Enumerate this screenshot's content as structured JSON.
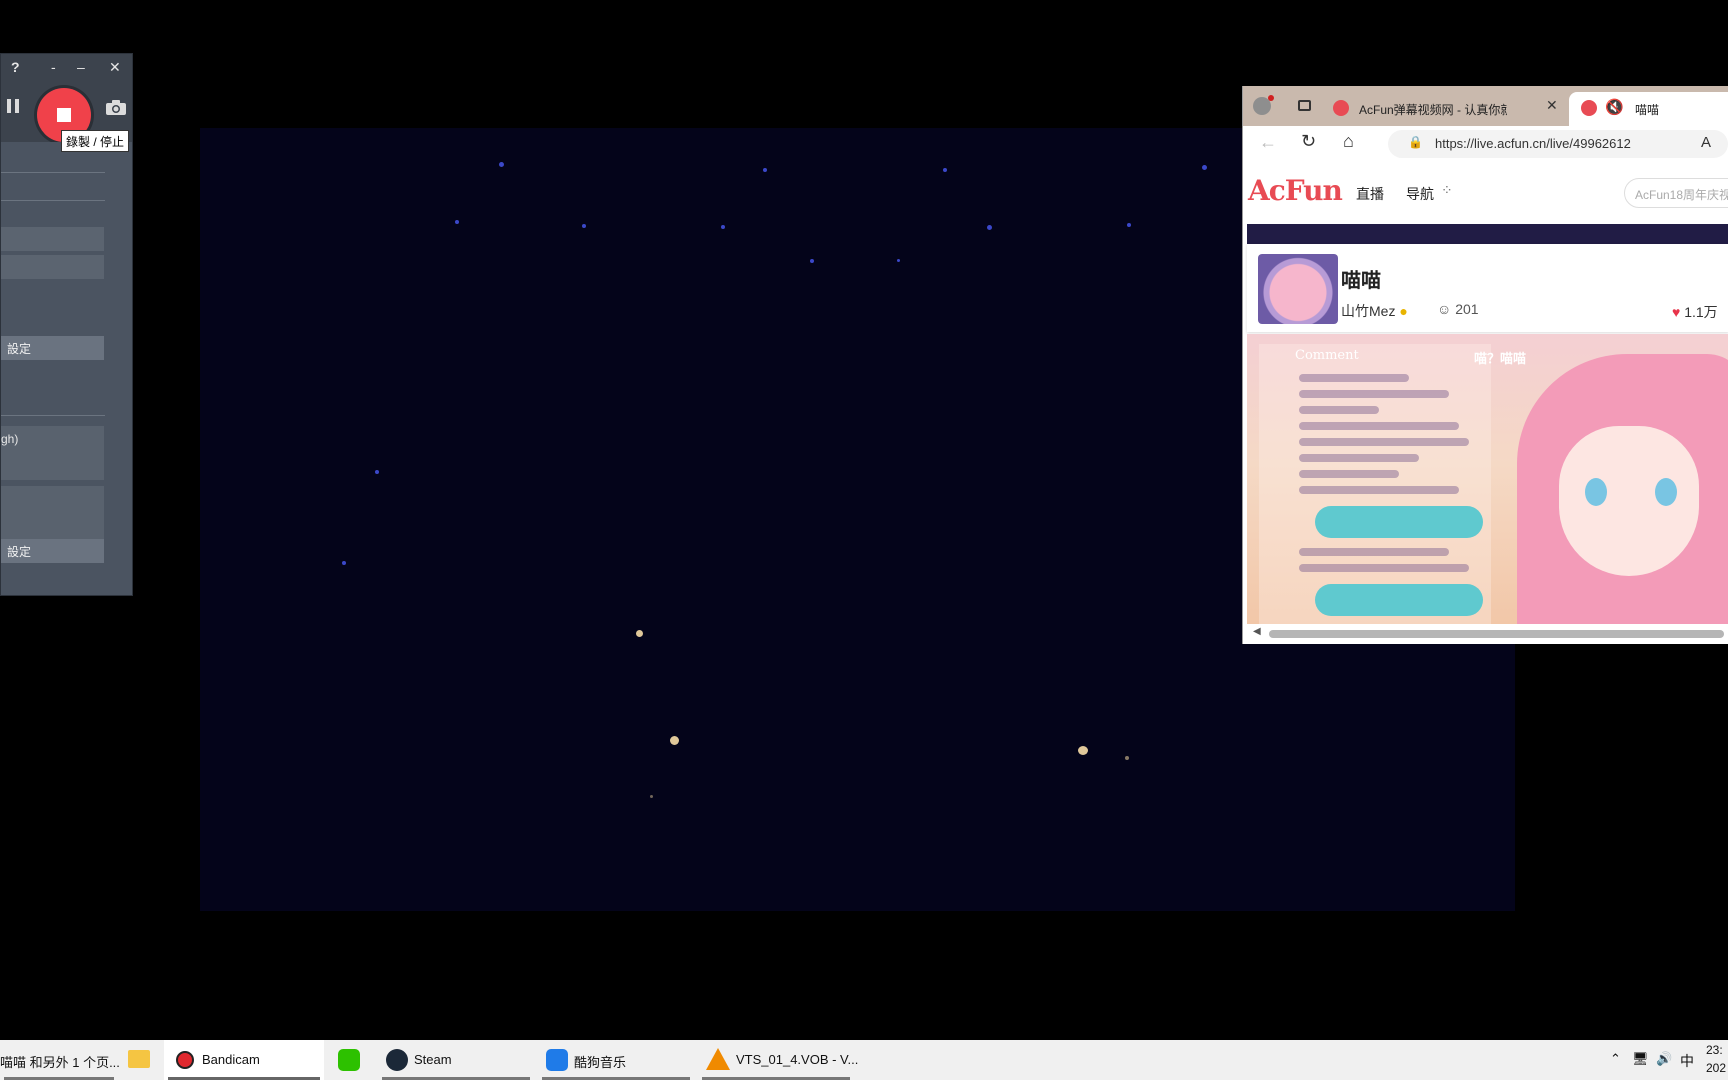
{
  "bandicam": {
    "help": "?",
    "minimize": "-",
    "restore": "–",
    "close": "✕",
    "tooltip": "錄製 / 停止",
    "settings_label_1": "設定",
    "settings_label_2": "設定",
    "codec_text": "gh)"
  },
  "browser": {
    "tab1_title": "AcFun弹幕视频网 - 认真你就输啦",
    "tab2_title": "喵喵",
    "url": "https://live.acfun.cn/live/49962612",
    "reader_icon": "A"
  },
  "acfun": {
    "logo": "AcFun",
    "nav": [
      "直播",
      "导航"
    ],
    "search_placeholder": "AcFun18周年庆视",
    "room_title": "喵喵",
    "host": "山竹Mez",
    "viewers": "201",
    "likes": "1.1万",
    "overlay_title": "Comment",
    "overlay_name": "喵？喵喵"
  },
  "taskbar": {
    "items": [
      {
        "label": "喵喵 和另外 1 个页..."
      },
      {
        "label": "Bandicam"
      },
      {
        "label": "Steam"
      },
      {
        "label": "酷狗音乐"
      },
      {
        "label": "VTS_01_4.VOB - V..."
      }
    ],
    "ime": "中",
    "time": "23:",
    "date": "202"
  },
  "colors": {
    "record_red": "#f0414a",
    "acfun_red": "#e84b54",
    "video_bg": "#04041a"
  }
}
